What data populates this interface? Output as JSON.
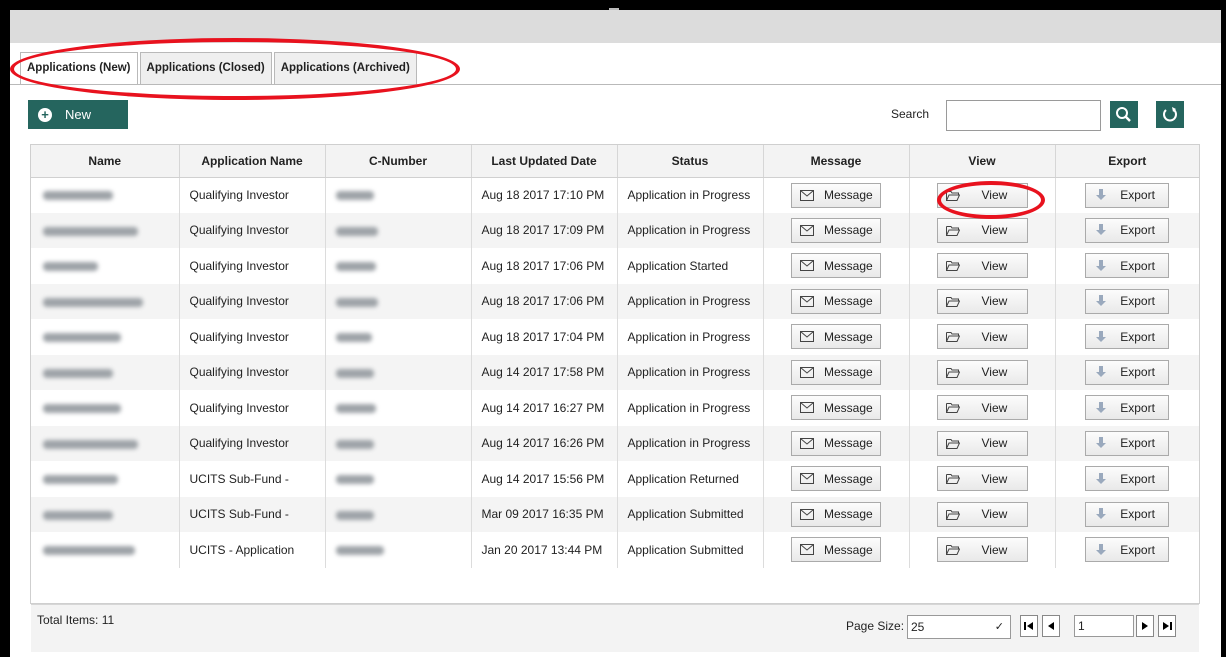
{
  "tabs": [
    {
      "label": "Applications (New)"
    },
    {
      "label": "Applications (Closed)"
    },
    {
      "label": "Applications (Archived)"
    }
  ],
  "toolbar": {
    "new_label": "New",
    "search_label": "Search",
    "search_value": ""
  },
  "columns": [
    "Name",
    "Application Name",
    "C-Number",
    "Last Updated Date",
    "Status",
    "Message",
    "View",
    "Export"
  ],
  "rows": [
    {
      "app": "Qualifying Investor",
      "updated": "Aug 18 2017 17:10 PM",
      "status": "Application in Progress"
    },
    {
      "app": "Qualifying Investor",
      "updated": "Aug 18 2017 17:09 PM",
      "status": "Application in Progress"
    },
    {
      "app": "Qualifying Investor",
      "updated": "Aug 18 2017 17:06 PM",
      "status": "Application Started"
    },
    {
      "app": "Qualifying Investor",
      "updated": "Aug 18 2017 17:06 PM",
      "status": "Application in Progress"
    },
    {
      "app": "Qualifying Investor",
      "updated": "Aug 18 2017 17:04 PM",
      "status": "Application in Progress"
    },
    {
      "app": "Qualifying Investor",
      "updated": "Aug 14 2017 17:58 PM",
      "status": "Application in Progress"
    },
    {
      "app": "Qualifying Investor",
      "updated": "Aug 14 2017 16:27 PM",
      "status": "Application in Progress"
    },
    {
      "app": "Qualifying Investor",
      "updated": "Aug 14 2017 16:26 PM",
      "status": "Application in Progress"
    },
    {
      "app": "UCITS Sub-Fund -",
      "updated": "Aug 14 2017 15:56 PM",
      "status": "Application Returned"
    },
    {
      "app": "UCITS Sub-Fund -",
      "updated": "Mar 09 2017 16:35 PM",
      "status": "Application Submitted"
    },
    {
      "app": "UCITS - Application",
      "updated": "Jan 20 2017 13:44 PM",
      "status": "Application Submitted"
    }
  ],
  "row_buttons": {
    "message": "Message",
    "view": "View",
    "export": "Export"
  },
  "footer": {
    "total_items": "Total Items: 11",
    "page_size_label": "Page Size:",
    "page_size_value": "25",
    "page_number": "1"
  },
  "colors": {
    "accent": "#25655e",
    "annotation": "#e8121e"
  },
  "icons": {
    "new": "plus-circle-icon",
    "search": "magnifier-icon",
    "refresh": "refresh-icon",
    "message": "envelope-icon",
    "view": "folder-icon",
    "export": "download-arrow-icon",
    "pager": [
      "first-page-icon",
      "prev-page-icon",
      "next-page-icon",
      "last-page-icon"
    ]
  }
}
